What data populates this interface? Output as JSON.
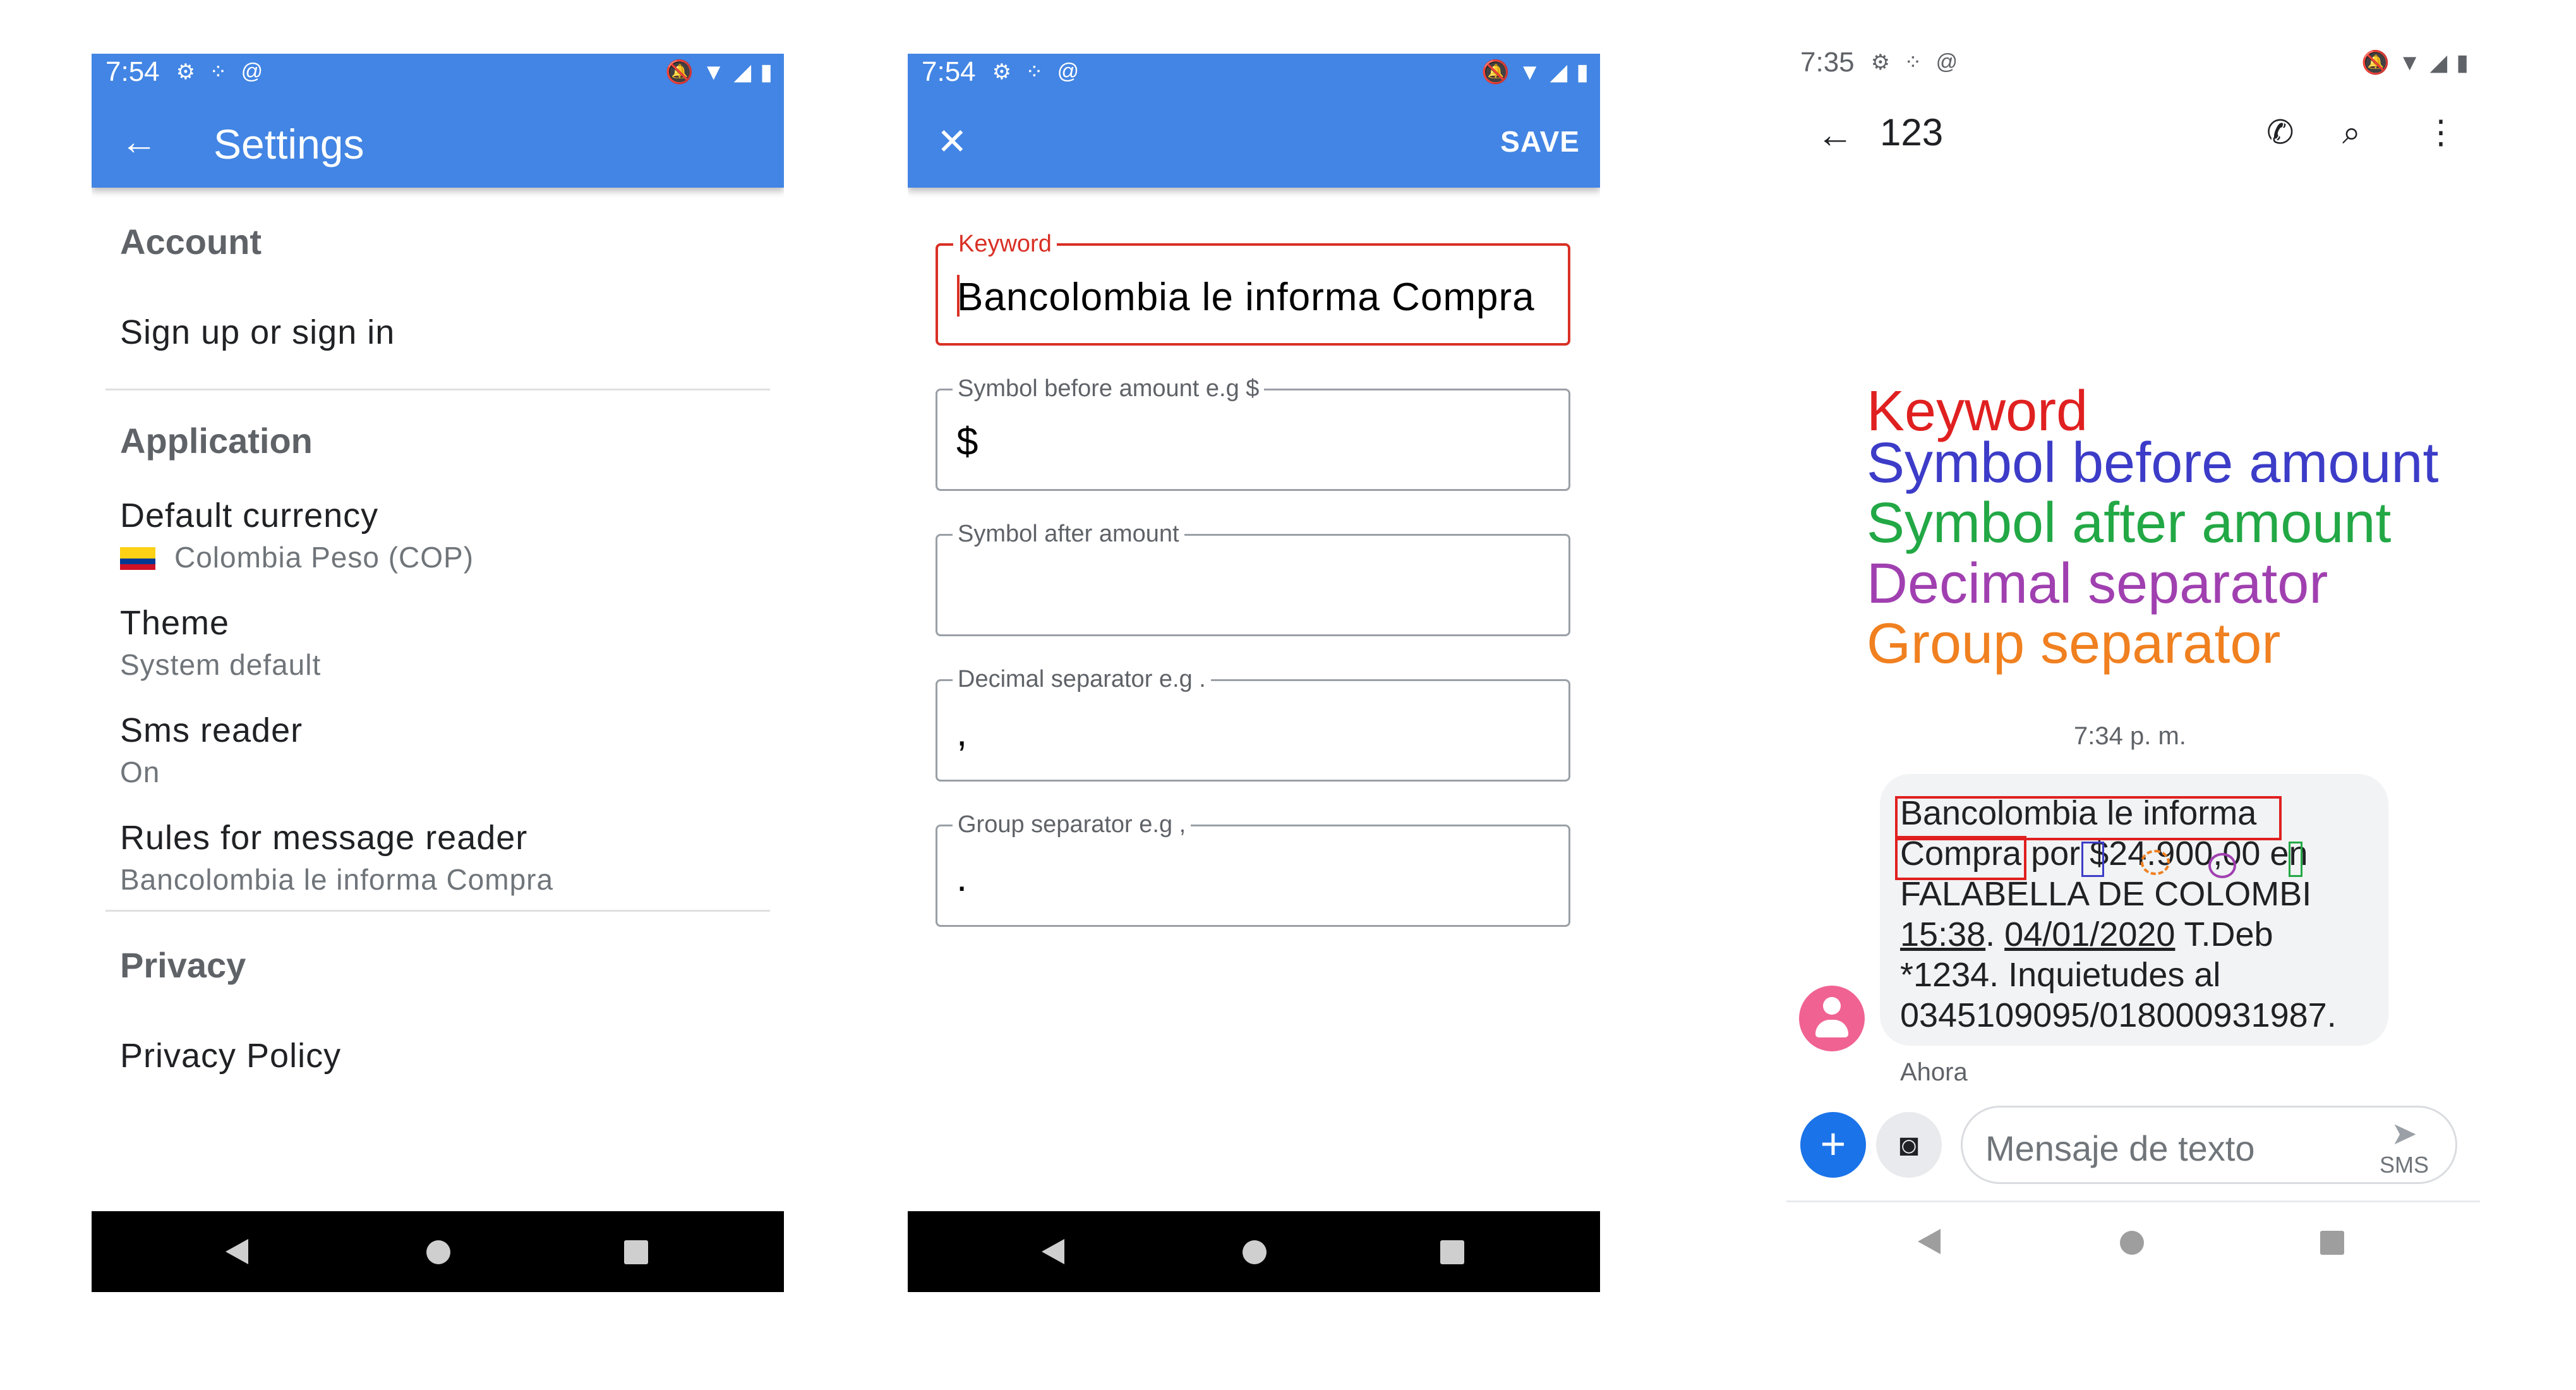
{
  "settings_screen": {
    "status": {
      "time": "7:54"
    },
    "title": "Settings",
    "sections": {
      "account": "Account",
      "application": "Application",
      "privacy": "Privacy"
    },
    "items": {
      "signin": "Sign up or sign in",
      "currency_title": "Default currency",
      "currency_value": "Colombia Peso (COP)",
      "theme_title": "Theme",
      "theme_value": "System default",
      "sms_title": "Sms reader",
      "sms_value": "On",
      "rules_title": "Rules for message reader",
      "rules_value": "Bancolombia le informa Compra",
      "privacy_policy": "Privacy Policy"
    }
  },
  "rule_editor": {
    "status": {
      "time": "7:54"
    },
    "save_label": "SAVE",
    "fields": {
      "keyword": {
        "label": "Keyword",
        "value": "Bancolombia le informa Compra"
      },
      "symbol_before": {
        "label": "Symbol before amount e.g $",
        "value": "$"
      },
      "symbol_after": {
        "label": "Symbol after amount",
        "value": ""
      },
      "decimal_sep": {
        "label": "Decimal separator e.g .",
        "value": ","
      },
      "group_sep": {
        "label": "Group separator e.g ,",
        "value": "."
      }
    }
  },
  "messages_screen": {
    "status": {
      "time": "7:35"
    },
    "contact": "123",
    "legend": {
      "keyword": "Keyword",
      "symbol_before": "Symbol before amount",
      "symbol_after": "Symbol after amount",
      "decimal": "Decimal separator",
      "group": "Group separator"
    },
    "legend_colors": {
      "keyword": "#e02020",
      "symbol_before": "#3c3cc8",
      "symbol_after": "#22a845",
      "decimal": "#a040b0",
      "group": "#f08020"
    },
    "timestamp": "7:34 p. m.",
    "message": {
      "kw1": "Bancolombia le informa",
      "kw2": "Compra",
      "por": " por ",
      "sym": "$",
      "amount": "24.900,00",
      "en": " en",
      "line3": "FALABELLA DE COLOMBI",
      "time": "15:38",
      "dot": ". ",
      "date": "04/01/2020",
      "tdeb": " T.Deb",
      "line5": "*1234. Inquietudes al",
      "line6": "0345109095/018000931987."
    },
    "ahora": "Ahora",
    "compose_placeholder": "Mensaje de texto",
    "sms_label": "SMS"
  },
  "icons": {
    "back": "arrow-left-icon",
    "close": "close-icon",
    "phone": "phone-icon",
    "search": "search-icon",
    "more": "more-vert-icon"
  },
  "colors": {
    "app_bar": "#4285e4",
    "error_red": "#d93025",
    "fab_blue": "#1a73e8",
    "avatar_pink": "#f06292"
  }
}
